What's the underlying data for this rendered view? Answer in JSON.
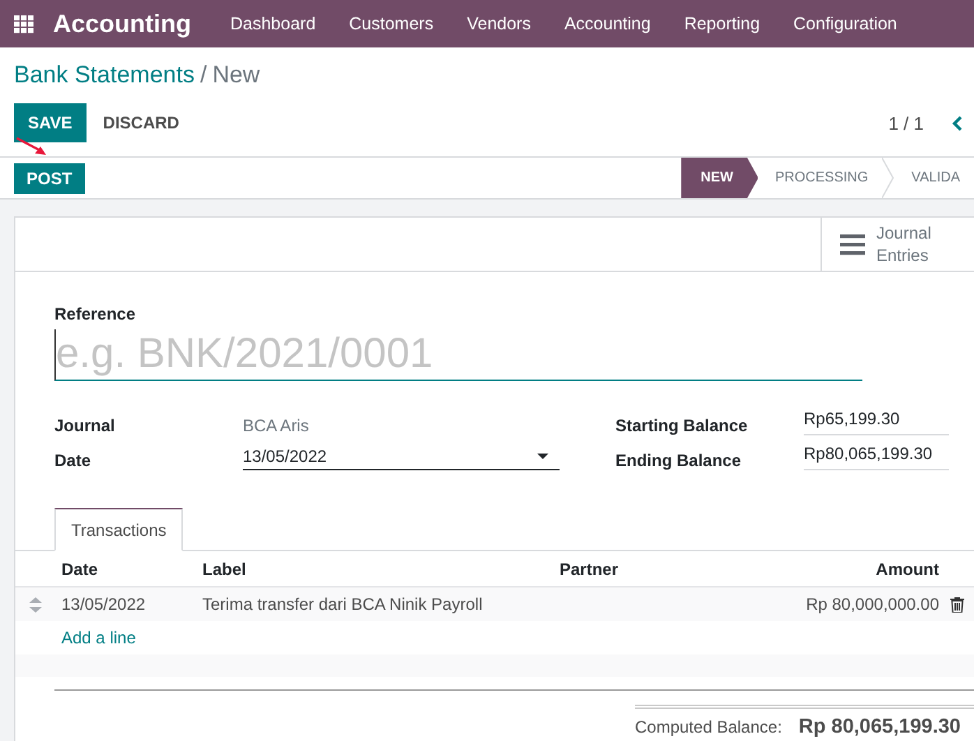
{
  "navbar": {
    "app_name": "Accounting",
    "menu": [
      "Dashboard",
      "Customers",
      "Vendors",
      "Accounting",
      "Reporting",
      "Configuration"
    ]
  },
  "breadcrumb": {
    "parent": "Bank Statements",
    "separator": "/",
    "current": "New"
  },
  "actions": {
    "save": "SAVE",
    "discard": "DISCARD",
    "pager": "1 / 1"
  },
  "header_buttons": [
    "POST"
  ],
  "status_steps": [
    {
      "label": "NEW",
      "selected": true
    },
    {
      "label": "PROCESSING",
      "selected": false
    },
    {
      "label": "VALIDA",
      "selected": false
    }
  ],
  "smart_button": {
    "label": "Journal Entries"
  },
  "reference": {
    "label": "Reference",
    "placeholder": "e.g. BNK/2021/0001"
  },
  "fields_left": [
    {
      "label": "Journal",
      "value": "BCA Aris",
      "kind": "readonly"
    },
    {
      "label": "Date",
      "value": "13/05/2022",
      "kind": "dropdown"
    }
  ],
  "fields_right": [
    {
      "label": "Starting Balance",
      "value": "Rp65,199.30"
    },
    {
      "label": "Ending Balance",
      "value": "Rp80,065,199.30"
    }
  ],
  "tabs": [
    {
      "label": "Transactions",
      "selected": true
    }
  ],
  "table": {
    "columns": [
      "Date",
      "Label",
      "Partner",
      "Amount"
    ],
    "rows": [
      {
        "date": "13/05/2022",
        "label": "Terima transfer dari BCA Ninik Payroll",
        "amount": "Rp 80,000,000.00"
      }
    ],
    "add_line": "Add a line"
  },
  "computed_balance": {
    "label": "Computed Balance:",
    "value": "Rp 80,065,199.30"
  }
}
